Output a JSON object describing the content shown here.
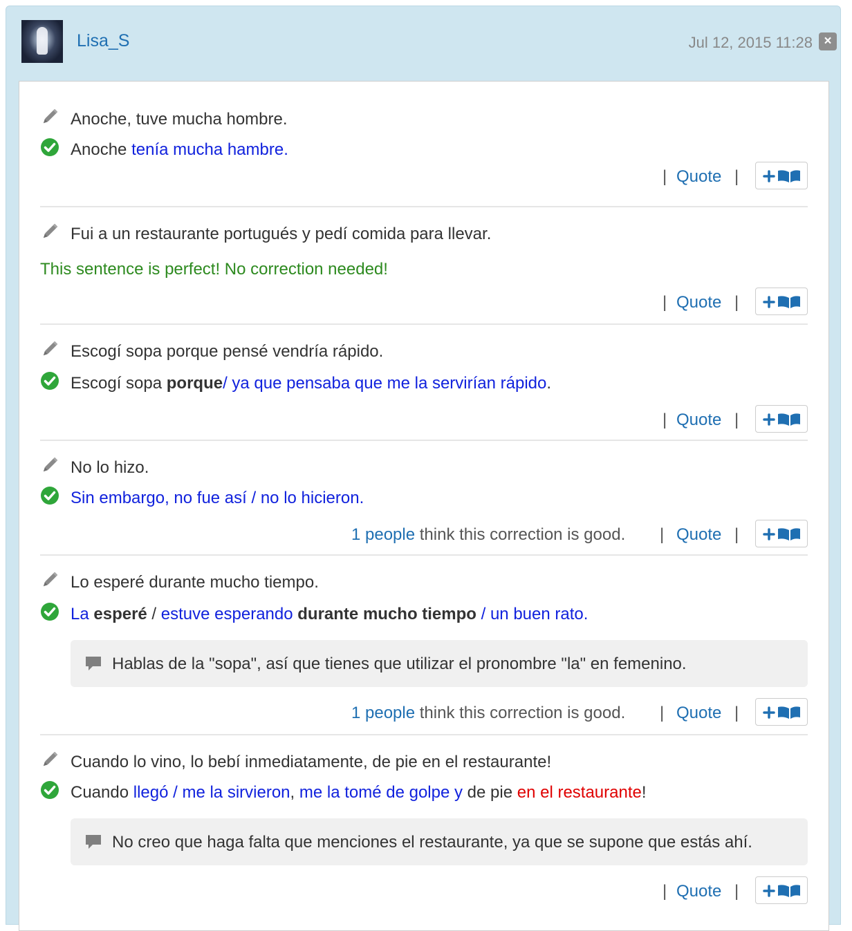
{
  "header": {
    "username": "Lisa_S",
    "date": "Jul 12, 2015 11:28",
    "close_label": "×"
  },
  "corrections": [
    {
      "original": "Anoche, tuve mucha hombre.",
      "corrected": [
        {
          "text": "Anoche ",
          "style": "plain"
        },
        {
          "text": "tenía mucha hambre.",
          "style": "blue"
        }
      ],
      "quote": "Quote"
    },
    {
      "original": "Fui a un restaurante portugués y pedí comida para llevar.",
      "perfect": "This sentence is perfect! No correction needed!",
      "quote": "Quote"
    },
    {
      "original": "Escogí sopa porque pensé vendría rápido.",
      "corrected": [
        {
          "text": "Escogí sopa ",
          "style": "plain"
        },
        {
          "text": "porque",
          "style": "bold"
        },
        {
          "text": "/ ya que pensaba que me la servirían rápido",
          "style": "blue"
        },
        {
          "text": ".",
          "style": "plain"
        }
      ],
      "quote": "Quote"
    },
    {
      "original": "No lo hizo.",
      "corrected": [
        {
          "text": "Sin embargo, no fue así / no lo hicieron.",
          "style": "blue"
        }
      ],
      "votes_count": "1 people",
      "votes_text": " think this correction is good.",
      "quote": "Quote"
    },
    {
      "original": "Lo esperé durante mucho tiempo.",
      "corrected": [
        {
          "text": "La ",
          "style": "blue"
        },
        {
          "text": "esperé",
          "style": "bold"
        },
        {
          "text": " / ",
          "style": "plain"
        },
        {
          "text": "estuve esperando",
          "style": "blue"
        },
        {
          "text": " durante mucho tiempo",
          "style": "bold"
        },
        {
          "text": " / un buen rato.",
          "style": "blue"
        }
      ],
      "comment": "Hablas de la \"sopa\", así que tienes que utilizar el pronombre \"la\" en femenino.",
      "votes_count": "1 people",
      "votes_text": " think this correction is good.",
      "quote": "Quote"
    },
    {
      "original": "Cuando lo vino, lo bebí inmediatamente, de pie en el restaurante!",
      "corrected": [
        {
          "text": "Cuando ",
          "style": "plain"
        },
        {
          "text": "llegó / me la sirvieron",
          "style": "blue"
        },
        {
          "text": ", ",
          "style": "plain"
        },
        {
          "text": "me la tomé de golpe y",
          "style": "blue"
        },
        {
          "text": " de pie ",
          "style": "plain"
        },
        {
          "text": "en el restaurante",
          "style": "red"
        },
        {
          "text": "!",
          "style": "plain"
        }
      ],
      "comment": "No creo que haga falta que menciones el restaurante, ya que se supone que estás ahí.",
      "quote": "Quote"
    }
  ],
  "sep": "|",
  "colors": {
    "blue_text": "#1122dd",
    "link": "#1f6fb2",
    "green_text": "#2d8a1f",
    "red_text": "#e00000",
    "check_green": "#2fa63a",
    "header_bg": "#cfe6f0"
  },
  "icons": [
    "pencil-icon",
    "check-circle-icon",
    "comment-icon",
    "plus-icon",
    "book-icon",
    "close-icon"
  ]
}
